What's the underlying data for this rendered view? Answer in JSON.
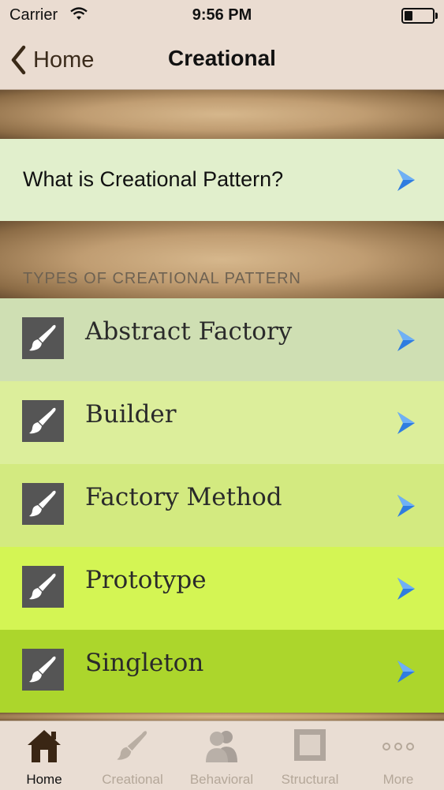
{
  "status": {
    "carrier": "Carrier",
    "time": "9:56 PM"
  },
  "nav": {
    "back_label": "Home",
    "title": "Creational"
  },
  "intro": {
    "label": "What is Creational Pattern?"
  },
  "section": {
    "header": "TYPES OF CREATIONAL PATTERN"
  },
  "types": [
    {
      "label": "Abstract Factory"
    },
    {
      "label": "Builder"
    },
    {
      "label": "Factory Method"
    },
    {
      "label": "Prototype"
    },
    {
      "label": "Singleton"
    }
  ],
  "tabs": [
    {
      "label": "Home",
      "icon": "house-icon",
      "active": true
    },
    {
      "label": "Creational",
      "icon": "paintbrush-icon"
    },
    {
      "label": "Behavioral",
      "icon": "people-icon"
    },
    {
      "label": "Structural",
      "icon": "frame-icon"
    },
    {
      "label": "More",
      "icon": "more-dots-icon"
    }
  ],
  "colors": {
    "chevron": "#2f7de0",
    "nav_bg": "#eadcd1",
    "tab_active": "#111111",
    "tab_inactive": "#b4a799"
  }
}
